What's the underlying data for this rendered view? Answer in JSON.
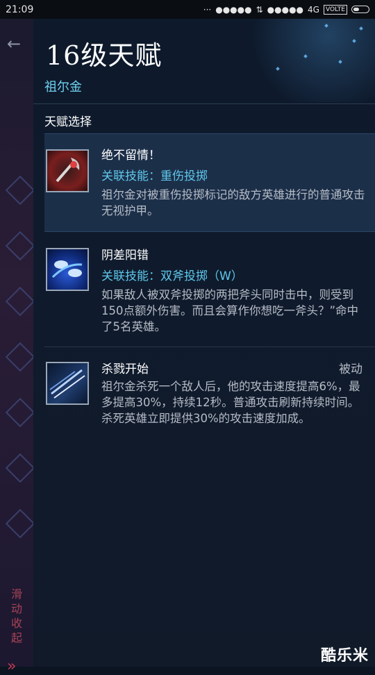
{
  "statusbar": {
    "time": "21:09",
    "dots": "···",
    "signal1": "●●●●●",
    "data_icon": "⇅",
    "signal2": "●●●●●",
    "network": "4G",
    "volte": "VOLTE"
  },
  "background": {
    "collapse_text": "滑动收起"
  },
  "panel": {
    "title": "16级天赋",
    "hero_name": "祖尔金",
    "section_label": "天赋选择"
  },
  "talents": [
    {
      "name": "绝不留情！",
      "skill": "关联技能：重伤投掷",
      "desc": "祖尔金对被重伤投掷标记的敌方英雄进行的普通攻击无视护甲。",
      "tag": "",
      "icon": "axe-red-icon",
      "selected": true
    },
    {
      "name": "阴差阳错",
      "skill": "关联技能：双斧投掷（W）",
      "desc": "如果敌人被双斧投掷的两把斧头同时击中，则受到150点额外伤害。而且会算作你想吃一斧头？”命中了5名英雄。",
      "tag": "",
      "icon": "twin-axes-blue-icon",
      "selected": false
    },
    {
      "name": "杀戮开始",
      "skill": "",
      "desc": "祖尔金杀死一个敌人后，他的攻击速度提高6%，最多提高30%，持续12秒。普通攻击刷新持续时间。\n杀死英雄立即提供30%的攻击速度加成。",
      "tag": "被动",
      "icon": "blades-icon",
      "selected": false
    }
  ],
  "watermark": "酷乐米",
  "colors": {
    "accent": "#5fc8ec",
    "selected_bg": "#1c2f49",
    "panel_bg": "#0f1b2d"
  }
}
